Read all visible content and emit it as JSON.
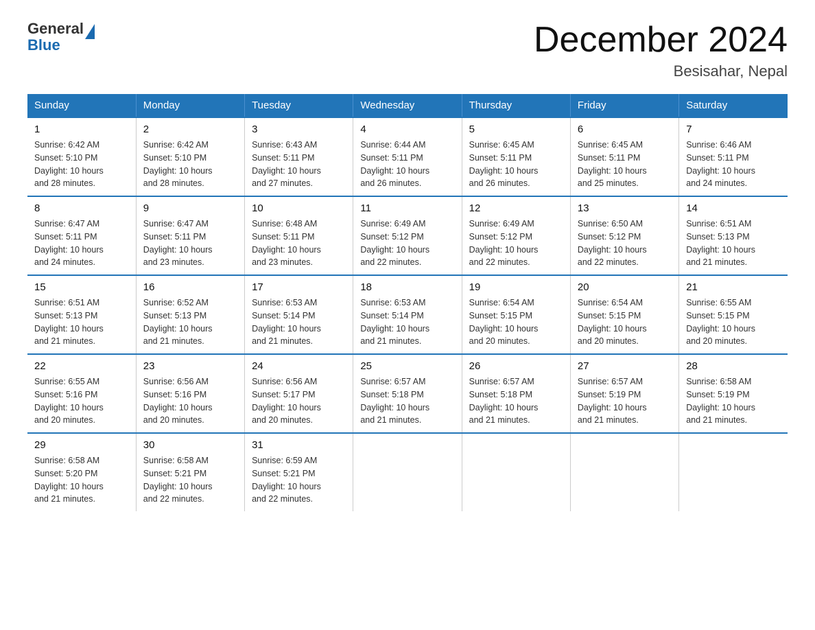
{
  "logo": {
    "text_general": "General",
    "text_blue": "Blue",
    "arrow": "▶"
  },
  "title": {
    "month_year": "December 2024",
    "location": "Besisahar, Nepal"
  },
  "days_of_week": [
    "Sunday",
    "Monday",
    "Tuesday",
    "Wednesday",
    "Thursday",
    "Friday",
    "Saturday"
  ],
  "weeks": [
    [
      {
        "day": "1",
        "sunrise": "6:42 AM",
        "sunset": "5:10 PM",
        "daylight": "10 hours and 28 minutes."
      },
      {
        "day": "2",
        "sunrise": "6:42 AM",
        "sunset": "5:10 PM",
        "daylight": "10 hours and 28 minutes."
      },
      {
        "day": "3",
        "sunrise": "6:43 AM",
        "sunset": "5:11 PM",
        "daylight": "10 hours and 27 minutes."
      },
      {
        "day": "4",
        "sunrise": "6:44 AM",
        "sunset": "5:11 PM",
        "daylight": "10 hours and 26 minutes."
      },
      {
        "day": "5",
        "sunrise": "6:45 AM",
        "sunset": "5:11 PM",
        "daylight": "10 hours and 26 minutes."
      },
      {
        "day": "6",
        "sunrise": "6:45 AM",
        "sunset": "5:11 PM",
        "daylight": "10 hours and 25 minutes."
      },
      {
        "day": "7",
        "sunrise": "6:46 AM",
        "sunset": "5:11 PM",
        "daylight": "10 hours and 24 minutes."
      }
    ],
    [
      {
        "day": "8",
        "sunrise": "6:47 AM",
        "sunset": "5:11 PM",
        "daylight": "10 hours and 24 minutes."
      },
      {
        "day": "9",
        "sunrise": "6:47 AM",
        "sunset": "5:11 PM",
        "daylight": "10 hours and 23 minutes."
      },
      {
        "day": "10",
        "sunrise": "6:48 AM",
        "sunset": "5:11 PM",
        "daylight": "10 hours and 23 minutes."
      },
      {
        "day": "11",
        "sunrise": "6:49 AM",
        "sunset": "5:12 PM",
        "daylight": "10 hours and 22 minutes."
      },
      {
        "day": "12",
        "sunrise": "6:49 AM",
        "sunset": "5:12 PM",
        "daylight": "10 hours and 22 minutes."
      },
      {
        "day": "13",
        "sunrise": "6:50 AM",
        "sunset": "5:12 PM",
        "daylight": "10 hours and 22 minutes."
      },
      {
        "day": "14",
        "sunrise": "6:51 AM",
        "sunset": "5:13 PM",
        "daylight": "10 hours and 21 minutes."
      }
    ],
    [
      {
        "day": "15",
        "sunrise": "6:51 AM",
        "sunset": "5:13 PM",
        "daylight": "10 hours and 21 minutes."
      },
      {
        "day": "16",
        "sunrise": "6:52 AM",
        "sunset": "5:13 PM",
        "daylight": "10 hours and 21 minutes."
      },
      {
        "day": "17",
        "sunrise": "6:53 AM",
        "sunset": "5:14 PM",
        "daylight": "10 hours and 21 minutes."
      },
      {
        "day": "18",
        "sunrise": "6:53 AM",
        "sunset": "5:14 PM",
        "daylight": "10 hours and 21 minutes."
      },
      {
        "day": "19",
        "sunrise": "6:54 AM",
        "sunset": "5:15 PM",
        "daylight": "10 hours and 20 minutes."
      },
      {
        "day": "20",
        "sunrise": "6:54 AM",
        "sunset": "5:15 PM",
        "daylight": "10 hours and 20 minutes."
      },
      {
        "day": "21",
        "sunrise": "6:55 AM",
        "sunset": "5:15 PM",
        "daylight": "10 hours and 20 minutes."
      }
    ],
    [
      {
        "day": "22",
        "sunrise": "6:55 AM",
        "sunset": "5:16 PM",
        "daylight": "10 hours and 20 minutes."
      },
      {
        "day": "23",
        "sunrise": "6:56 AM",
        "sunset": "5:16 PM",
        "daylight": "10 hours and 20 minutes."
      },
      {
        "day": "24",
        "sunrise": "6:56 AM",
        "sunset": "5:17 PM",
        "daylight": "10 hours and 20 minutes."
      },
      {
        "day": "25",
        "sunrise": "6:57 AM",
        "sunset": "5:18 PM",
        "daylight": "10 hours and 21 minutes."
      },
      {
        "day": "26",
        "sunrise": "6:57 AM",
        "sunset": "5:18 PM",
        "daylight": "10 hours and 21 minutes."
      },
      {
        "day": "27",
        "sunrise": "6:57 AM",
        "sunset": "5:19 PM",
        "daylight": "10 hours and 21 minutes."
      },
      {
        "day": "28",
        "sunrise": "6:58 AM",
        "sunset": "5:19 PM",
        "daylight": "10 hours and 21 minutes."
      }
    ],
    [
      {
        "day": "29",
        "sunrise": "6:58 AM",
        "sunset": "5:20 PM",
        "daylight": "10 hours and 21 minutes."
      },
      {
        "day": "30",
        "sunrise": "6:58 AM",
        "sunset": "5:21 PM",
        "daylight": "10 hours and 22 minutes."
      },
      {
        "day": "31",
        "sunrise": "6:59 AM",
        "sunset": "5:21 PM",
        "daylight": "10 hours and 22 minutes."
      },
      null,
      null,
      null,
      null
    ]
  ],
  "labels": {
    "sunrise": "Sunrise:",
    "sunset": "Sunset:",
    "daylight": "Daylight:"
  }
}
